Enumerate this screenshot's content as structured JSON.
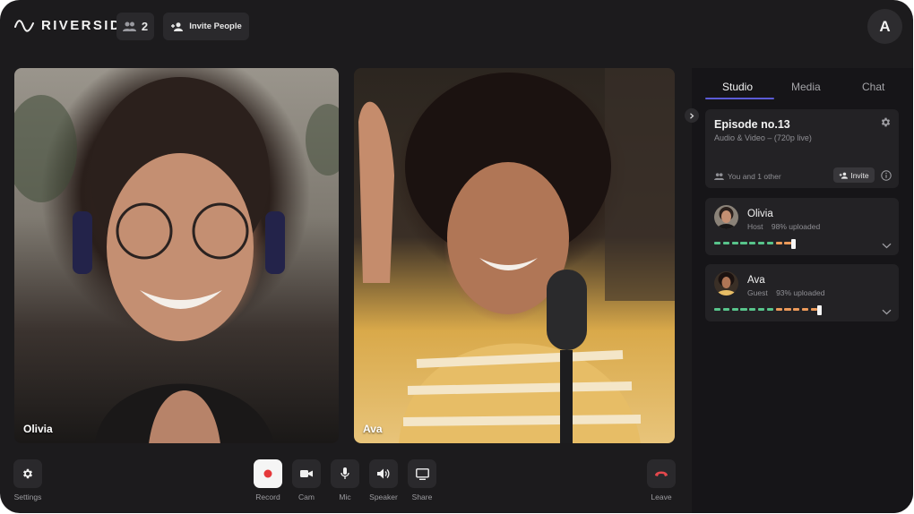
{
  "header": {
    "logo_text": "RIVERSIDE",
    "participant_count": "2",
    "invite_people_label": "Invite People",
    "avatar_initial": "A"
  },
  "videos": [
    {
      "name": "Olivia"
    },
    {
      "name": "Ava"
    }
  ],
  "controls": {
    "settings_label": "Settings",
    "record_label": "Record",
    "cam_label": "Cam",
    "mic_label": "Mic",
    "speaker_label": "Speaker",
    "share_label": "Share",
    "leave_label": "Leave",
    "record_color": "#e5383b",
    "leave_color": "#e5484d"
  },
  "panel": {
    "tabs": [
      {
        "label": "Studio",
        "active": true
      },
      {
        "label": "Media",
        "active": false
      },
      {
        "label": "Chat",
        "active": false
      }
    ],
    "episode": {
      "title": "Episode no.13",
      "subtitle": "Audio & Video – (720p live)",
      "participants_text": "You and 1 other",
      "invite_label": "Invite"
    },
    "people": [
      {
        "name": "Olivia",
        "role": "Host",
        "upload_text": "98% uploaded",
        "upload_percent": 98,
        "green_segments": 7,
        "orange_segments": 2
      },
      {
        "name": "Ava",
        "role": "Guest",
        "upload_text": "93% uploaded",
        "upload_percent": 93,
        "green_segments": 7,
        "orange_segments": 5
      }
    ]
  },
  "colors": {
    "accent": "#5b5bd6",
    "upload_green": "#58c48b",
    "upload_orange": "#ec9a5a"
  }
}
